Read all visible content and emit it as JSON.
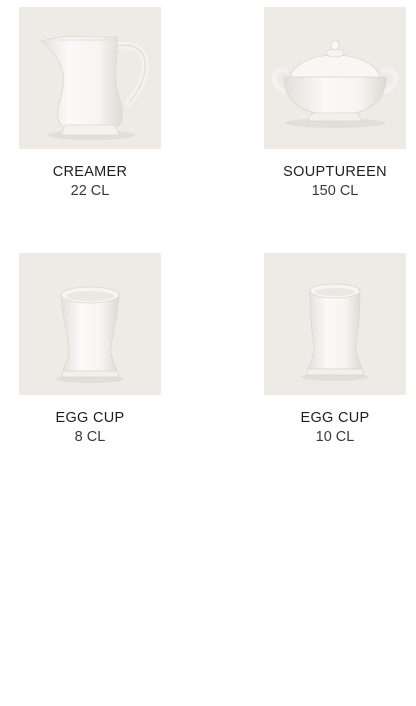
{
  "products": [
    {
      "name": "CREAMER",
      "capacity": "22 CL",
      "image_icon": "creamer-icon"
    },
    {
      "name": "SOUPTUREEN",
      "capacity": "150 CL",
      "image_icon": "souptureen-icon"
    },
    {
      "name": "EGG CUP",
      "capacity": "8 CL",
      "image_icon": "egg-cup-icon"
    },
    {
      "name": "EGG CUP",
      "capacity": "10 CL",
      "image_icon": "egg-cup-icon"
    }
  ],
  "colors": {
    "photo_background": "#eeebe6",
    "porcelain": "#fbfaf8",
    "text": "#1e1e1e"
  }
}
